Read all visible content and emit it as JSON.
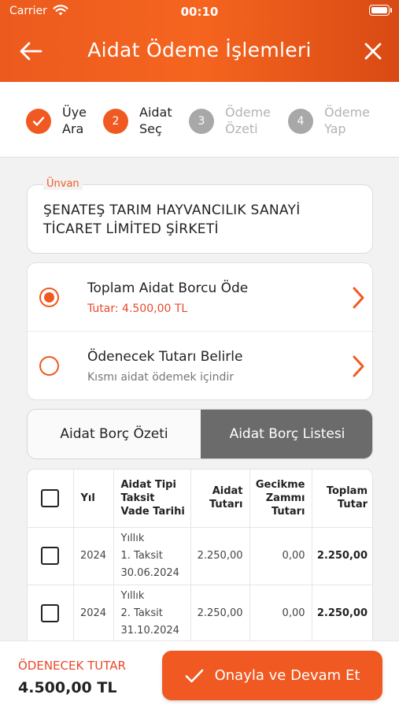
{
  "status": {
    "carrier": "Carrier",
    "time": "00:10"
  },
  "nav": {
    "title": "Aidat Ödeme İşlemleri"
  },
  "steps": [
    {
      "label_line1": "Üye",
      "label_line2": "Ara",
      "number": "",
      "state": "done"
    },
    {
      "label_line1": "Aidat",
      "label_line2": "Seç",
      "number": "2",
      "state": "active"
    },
    {
      "label_line1": "Ödeme",
      "label_line2": "Özeti",
      "number": "3",
      "state": "pending"
    },
    {
      "label_line1": "Ödeme",
      "label_line2": "Yap",
      "number": "4",
      "state": "pending"
    }
  ],
  "unvan": {
    "label": "Ünvan",
    "value": "ŞENATEŞ TARIM HAYVANCILIK SANAYİ TİCARET LİMİTED ŞİRKETİ"
  },
  "options": [
    {
      "title": "Toplam Aidat Borcu Öde",
      "subtitle": "Tutar: 4.500,00 TL",
      "selected": true
    },
    {
      "title": "Ödenecek Tutarı Belirle",
      "subtitle": "Kısmı aidat ödemek içindir",
      "selected": false
    }
  ],
  "segment": {
    "left": "Aidat Borç Özeti",
    "right": "Aidat Borç Listesi",
    "selected": "right"
  },
  "table": {
    "headers": {
      "yil": "Yıl",
      "tip_1": "Aidat Tipi",
      "tip_2": "Taksit",
      "tip_3": "Vade Tarihi",
      "tutar_1": "Aidat",
      "tutar_2": "Tutarı",
      "gecikme_1": "Gecikme",
      "gecikme_2": "Zammı",
      "gecikme_3": "Tutarı",
      "toplam_1": "Toplam",
      "toplam_2": "Tutar"
    },
    "rows": [
      {
        "yil": "2024",
        "tip": "Yıllık",
        "taksit": "1. Taksit",
        "vade": "30.06.2024",
        "tutar": "2.250,00",
        "gecikme": "0,00",
        "toplam": "2.250,00"
      },
      {
        "yil": "2024",
        "tip": "Yıllık",
        "taksit": "2. Taksit",
        "vade": "31.10.2024",
        "tutar": "2.250,00",
        "gecikme": "0,00",
        "toplam": "2.250,00"
      }
    ]
  },
  "footer": {
    "label": "ÖDENECEK TUTAR",
    "amount": "4.500,00 TL",
    "button": "Onayla ve Devam Et"
  },
  "colors": {
    "accent": "#f05a22",
    "header_gradient_end": "#d94a14",
    "segment_active": "#6b6b6b"
  }
}
